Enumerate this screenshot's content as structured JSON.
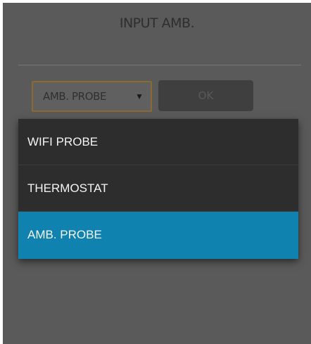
{
  "dialog": {
    "title": "INPUT AMB."
  },
  "select": {
    "value": "AMB. PROBE",
    "arrow": "▼"
  },
  "ok_button": {
    "label": "OK",
    "enabled": false
  },
  "dropdown": {
    "options": [
      {
        "label": "WIFI PROBE",
        "selected": false
      },
      {
        "label": "THERMOSTAT",
        "selected": false
      },
      {
        "label": "AMB. PROBE",
        "selected": true
      }
    ]
  },
  "colors": {
    "selected": "#0f82b0",
    "menu_bg": "#2d2d2d",
    "screen_bg": "#5a5a5a"
  }
}
